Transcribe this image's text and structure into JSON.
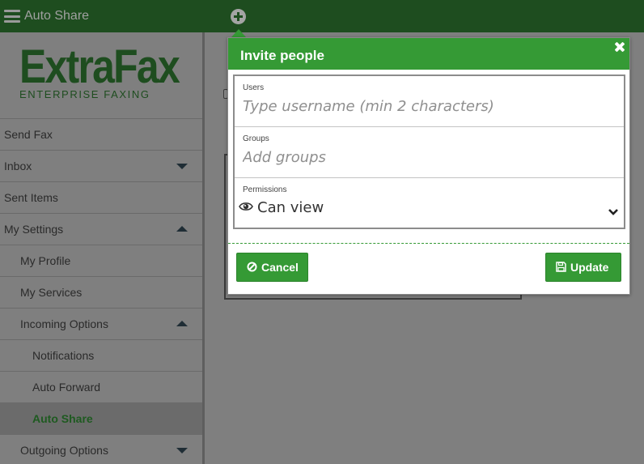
{
  "header": {
    "menu_icon": "hamburger-icon",
    "title": "Auto Share",
    "add_icon": "plus-circle-icon"
  },
  "logo": {
    "main": "ExtraFax",
    "sub": "ENTERPRISE FAXING"
  },
  "sidebar": {
    "items": [
      {
        "label": "Send Fax",
        "level": 0,
        "toggle": null
      },
      {
        "label": "Inbox",
        "level": 0,
        "toggle": "down"
      },
      {
        "label": "Sent Items",
        "level": 0,
        "toggle": null
      },
      {
        "label": "My Settings",
        "level": 0,
        "toggle": "up"
      },
      {
        "label": "My Profile",
        "level": 1,
        "toggle": null
      },
      {
        "label": "My Services",
        "level": 1,
        "toggle": null
      },
      {
        "label": "Incoming Options",
        "level": 1,
        "toggle": "up"
      },
      {
        "label": "Notifications",
        "level": 2,
        "toggle": null
      },
      {
        "label": "Auto Forward",
        "level": 2,
        "toggle": null
      },
      {
        "label": "Auto Share",
        "level": 2,
        "toggle": null,
        "active": true
      },
      {
        "label": "Outgoing Options",
        "level": 1,
        "toggle": "down"
      }
    ]
  },
  "popup": {
    "title": "Invite people",
    "close_icon": "close-icon",
    "users": {
      "label": "Users",
      "value": "",
      "placeholder": "Type username (min 2 characters)"
    },
    "groups": {
      "label": "Groups",
      "value": "",
      "placeholder": "Add groups"
    },
    "permissions": {
      "label": "Permissions",
      "value": "Can view",
      "icon": "eye-icon"
    },
    "cancel_label": "Cancel",
    "update_label": "Update"
  },
  "colors": {
    "header_bg": "#1e4d1f",
    "accent": "#359a35",
    "overlay": "#7f7f7f"
  }
}
